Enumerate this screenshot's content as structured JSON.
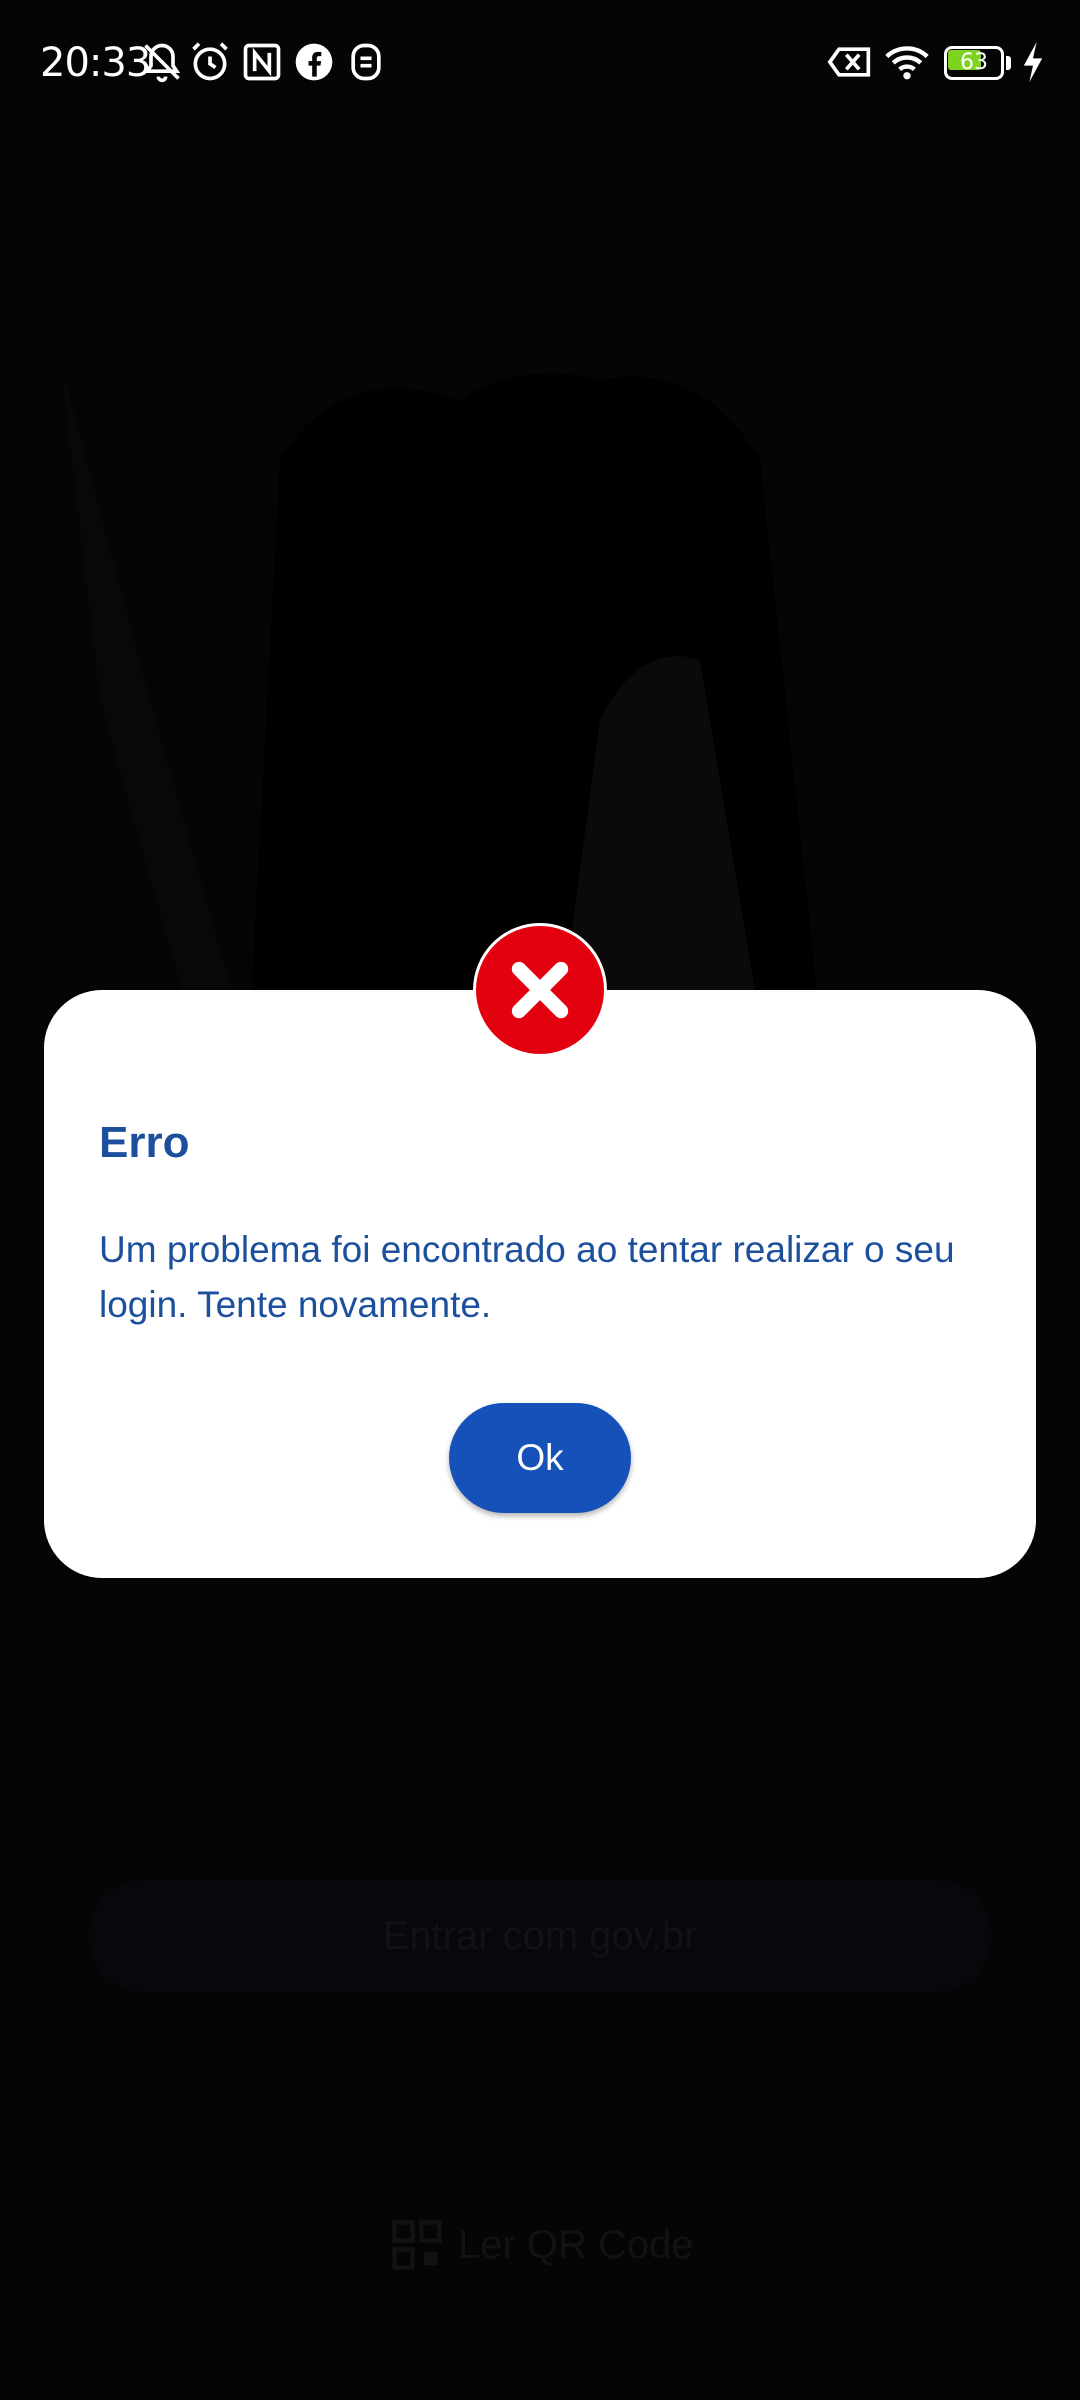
{
  "status_bar": {
    "time": "20:33",
    "battery_level": "63",
    "battery_fraction": 0.63,
    "icons": [
      "notifications-muted-icon",
      "alarm-icon",
      "nfc-icon",
      "facebook-icon",
      "app-notification-icon",
      "no-sim-icon",
      "wifi-icon",
      "battery-icon",
      "charging-icon"
    ]
  },
  "background_app": {
    "login_button_label": "Entrar com gov.br",
    "footnote_text": "",
    "qr_button_label": "Ler QR Code",
    "version_text": ""
  },
  "dialog": {
    "icon": "error-x-icon",
    "title": "Erro",
    "message": "Um problema foi encontrado ao tentar realizar o seu login. Tente novamente.",
    "ok_label": "Ok"
  },
  "colors": {
    "scrim": "#050505",
    "dialog_background": "#ffffff",
    "title_text": "#1c4f9c",
    "primary_button": "#1551b8",
    "error_red": "#e3000f",
    "battery_green": "#7ed320"
  }
}
